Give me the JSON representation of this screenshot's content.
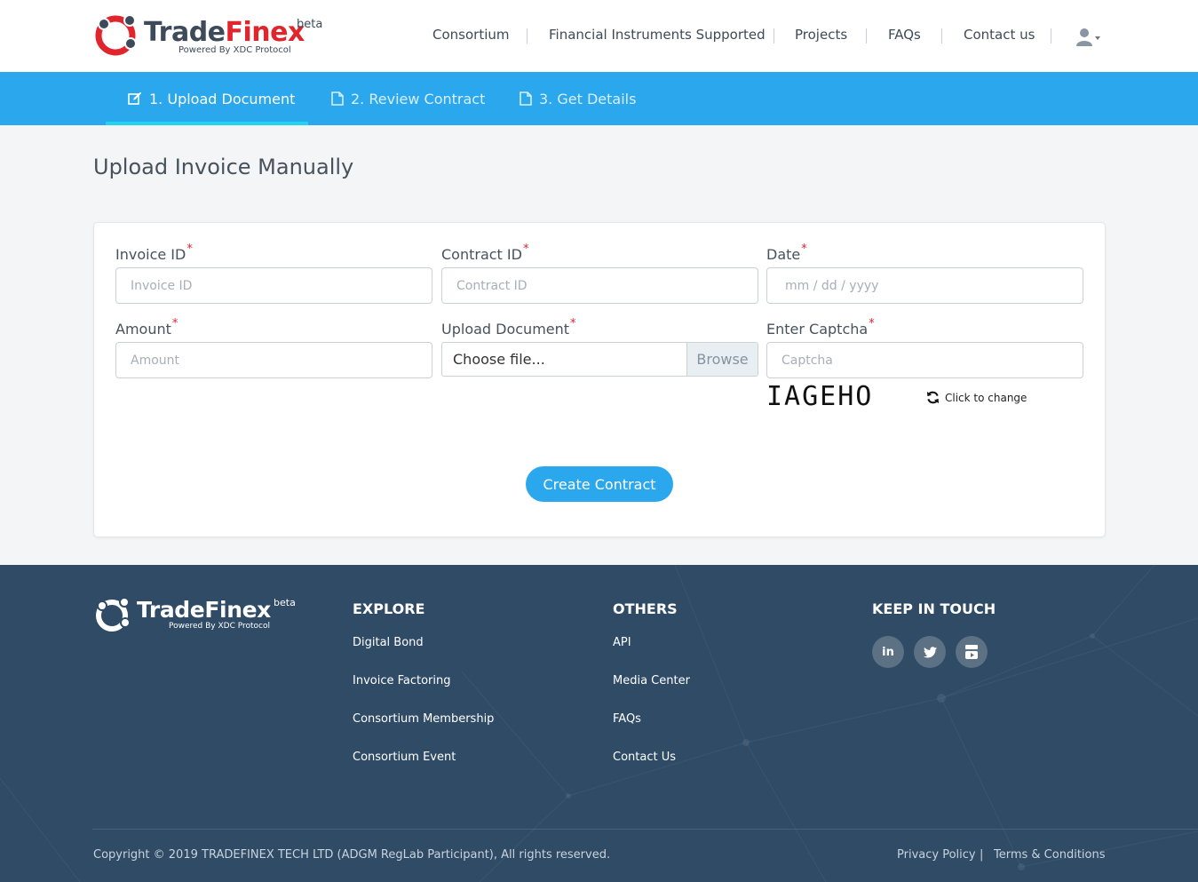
{
  "brand": {
    "name_part1": "Trade",
    "name_part2": "Finex",
    "beta": "beta",
    "tagline": "Powered By XDC Protocol"
  },
  "topnav": {
    "items": [
      {
        "label": "Consortium"
      },
      {
        "label": "Financial Instruments Supported"
      },
      {
        "label": "Projects"
      },
      {
        "label": "FAQs"
      },
      {
        "label": "Contact us"
      }
    ],
    "user_icon": "user-dropdown-icon"
  },
  "steps": [
    {
      "label": "1. Upload Document",
      "icon": "edit-icon",
      "active": true
    },
    {
      "label": "2. Review Contract",
      "icon": "document-icon",
      "active": false
    },
    {
      "label": "3. Get Details",
      "icon": "document-icon",
      "active": false
    }
  ],
  "page": {
    "title": "Upload Invoice Manually"
  },
  "form": {
    "required_mark": "*",
    "invoice_id": {
      "label": "Invoice ID",
      "placeholder": "Invoice ID",
      "value": ""
    },
    "contract_id": {
      "label": "Contract ID",
      "placeholder": "Contract ID",
      "value": ""
    },
    "date": {
      "label": "Date",
      "placeholder": "mm / dd / yyyy",
      "value": ""
    },
    "amount": {
      "label": "Amount",
      "placeholder": "Amount",
      "value": ""
    },
    "upload": {
      "label": "Upload Document",
      "choose_text": "Choose file...",
      "browse_label": "Browse"
    },
    "captcha": {
      "label": "Enter Captcha",
      "placeholder": "Captcha",
      "value": "",
      "image_text": "IAGEHO",
      "change_label": "Click to change"
    },
    "submit_label": "Create Contract"
  },
  "footer": {
    "explore": {
      "heading": "EXPLORE",
      "links": [
        "Digital Bond",
        "Invoice Factoring",
        "Consortium Membership",
        "Consortium Event"
      ]
    },
    "others": {
      "heading": "OTHERS",
      "links": [
        "API",
        "Media Center",
        "FAQs",
        "Contact Us"
      ]
    },
    "keep_in_touch": {
      "heading": "KEEP IN TOUCH",
      "social": [
        {
          "icon": "linkedin-icon",
          "glyph": "in"
        },
        {
          "icon": "twitter-icon",
          "glyph": ""
        },
        {
          "icon": "youtube-icon",
          "glyph": ""
        }
      ]
    },
    "copyright": "Copyright © 2019 TRADEFINEX TECH LTD (ADGM RegLab Participant), All rights reserved.",
    "privacy": "Privacy Policy",
    "legal_separator": "|",
    "terms": "Terms & Conditions"
  },
  "colors": {
    "accent": "#2ba7ed",
    "brand_red": "#e0252c",
    "footer_bg": "#2f4b66",
    "text_dark": "#47525d"
  }
}
